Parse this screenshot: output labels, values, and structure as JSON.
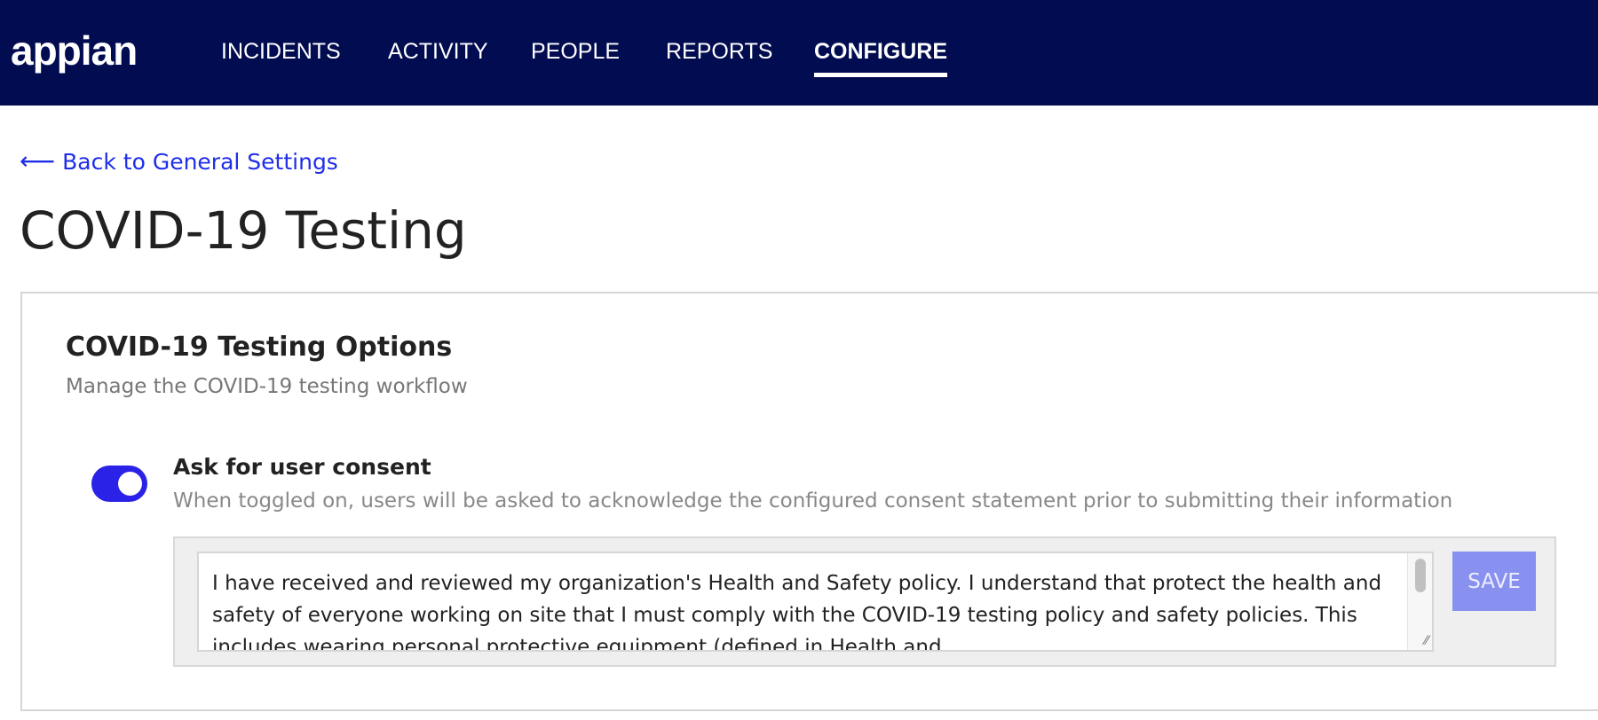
{
  "nav": {
    "logo": "appian",
    "items": [
      {
        "label": "INCIDENTS"
      },
      {
        "label": "ACTIVITY"
      },
      {
        "label": "PEOPLE"
      },
      {
        "label": "REPORTS"
      },
      {
        "label": "CONFIGURE",
        "active": true
      }
    ]
  },
  "back": {
    "arrow": "⟵",
    "label": "Back to General Settings"
  },
  "page_title": "COVID-19 Testing",
  "card": {
    "title": "COVID-19 Testing Options",
    "subtitle": "Manage the COVID-19 testing workflow",
    "consent": {
      "enabled": true,
      "label": "Ask for user consent",
      "description": "When toggled on, users will be asked to acknowledge the configured consent statement prior to submitting their information",
      "statement": "I have received and reviewed my organization's Health and Safety policy. I understand that protect the health and safety of everyone working on site that I must comply with the COVID-19 testing policy and safety policies. This includes wearing personal protective equipment (defined in Health and",
      "save_label": "SAVE"
    }
  },
  "colors": {
    "nav_bg": "#020c50",
    "accent": "#2a22e6",
    "save_disabled": "#8890f0",
    "link": "#1f2ee8"
  }
}
